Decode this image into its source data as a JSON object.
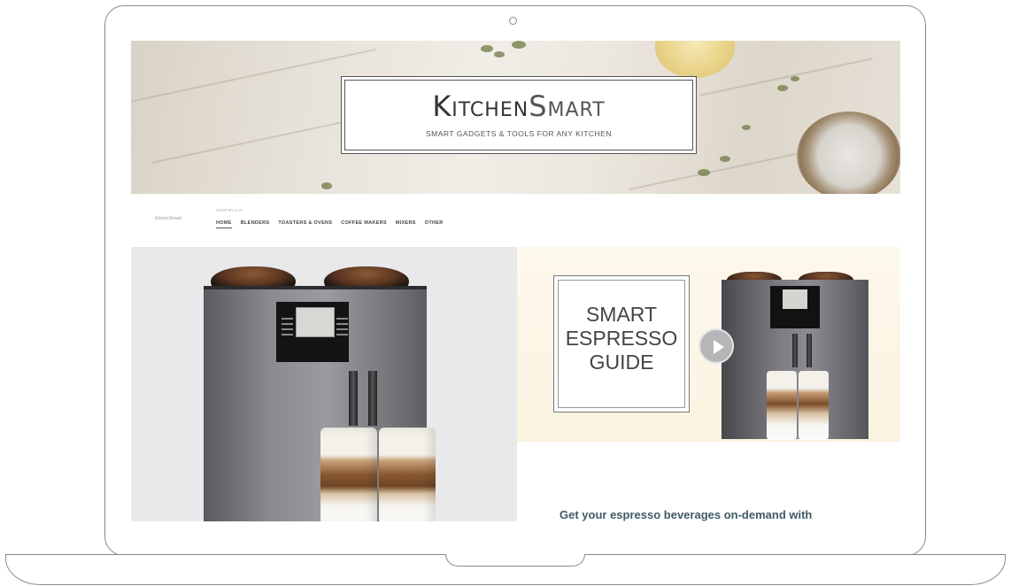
{
  "header": {
    "brand_bold": "Kitchen",
    "brand_light": "Smart",
    "tagline": "SMART GADGETS & TOOLS FOR ANY KITCHEN"
  },
  "nav": {
    "small_brand": "KitchenSmart",
    "breadcrumb": "SHOP BY CAT",
    "links": [
      "HOME",
      "BLENDERS",
      "TOASTERS & OVENS",
      "COFFEE MAKERS",
      "MIXERS",
      "OTHER"
    ],
    "active": "HOME"
  },
  "promo": {
    "guide_lines": [
      "SMART",
      "ESPRESSO",
      "GUIDE"
    ],
    "description": "Get your espresso beverages on-demand with"
  },
  "icons": {
    "play": "play-icon",
    "camera": "camera-icon"
  }
}
